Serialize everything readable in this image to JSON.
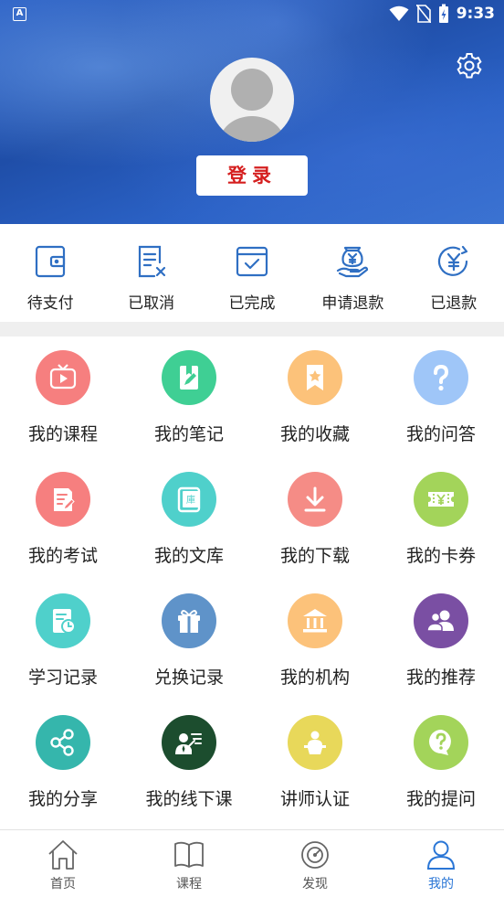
{
  "status_bar": {
    "time": "9:33",
    "left_icon_text": "A"
  },
  "profile": {
    "login_label": "登录"
  },
  "orders": [
    {
      "label": "待支付",
      "icon": "wallet-icon"
    },
    {
      "label": "已取消",
      "icon": "document-cancel-icon"
    },
    {
      "label": "已完成",
      "icon": "box-check-icon"
    },
    {
      "label": "申请退款",
      "icon": "refund-hand-icon"
    },
    {
      "label": "已退款",
      "icon": "yuan-refresh-icon"
    }
  ],
  "grid": [
    {
      "label": "我的课程",
      "icon": "play-tv-icon",
      "color": "#f67f7f"
    },
    {
      "label": "我的笔记",
      "icon": "notebook-pen-icon",
      "color": "#3fcf94"
    },
    {
      "label": "我的收藏",
      "icon": "bookmark-star-icon",
      "color": "#fcc27a"
    },
    {
      "label": "我的问答",
      "icon": "question-icon",
      "color": "#9fc6f8"
    },
    {
      "label": "我的考试",
      "icon": "exam-paper-icon",
      "color": "#f67f7f"
    },
    {
      "label": "我的文库",
      "icon": "library-book-icon",
      "color": "#4fd0cb"
    },
    {
      "label": "我的下载",
      "icon": "download-icon",
      "color": "#f58c86"
    },
    {
      "label": "我的卡券",
      "icon": "coupon-icon",
      "color": "#a3d45a"
    },
    {
      "label": "学习记录",
      "icon": "study-record-icon",
      "color": "#4fd0cb"
    },
    {
      "label": "兑换记录",
      "icon": "gift-box-icon",
      "color": "#5f93c9"
    },
    {
      "label": "我的机构",
      "icon": "institution-icon",
      "color": "#fcc27a"
    },
    {
      "label": "我的推荐",
      "icon": "users-icon",
      "color": "#7a4fa3"
    },
    {
      "label": "我的分享",
      "icon": "share-icon",
      "color": "#35b6ac"
    },
    {
      "label": "我的线下课",
      "icon": "teacher-board-icon",
      "color": "#1c4d2e"
    },
    {
      "label": "讲师认证",
      "icon": "lecturer-podium-icon",
      "color": "#e8d85a"
    },
    {
      "label": "我的提问",
      "icon": "question-bubble-icon",
      "color": "#a3d45a"
    }
  ],
  "tabs": [
    {
      "label": "首页",
      "icon": "home-icon",
      "active": false
    },
    {
      "label": "课程",
      "icon": "book-open-icon",
      "active": false
    },
    {
      "label": "发现",
      "icon": "compass-icon",
      "active": false
    },
    {
      "label": "我的",
      "icon": "person-icon",
      "active": true
    }
  ],
  "colors": {
    "accent_blue": "#2a76d6",
    "login_red": "#d51f1f",
    "order_icon_blue": "#2f6fc3"
  }
}
